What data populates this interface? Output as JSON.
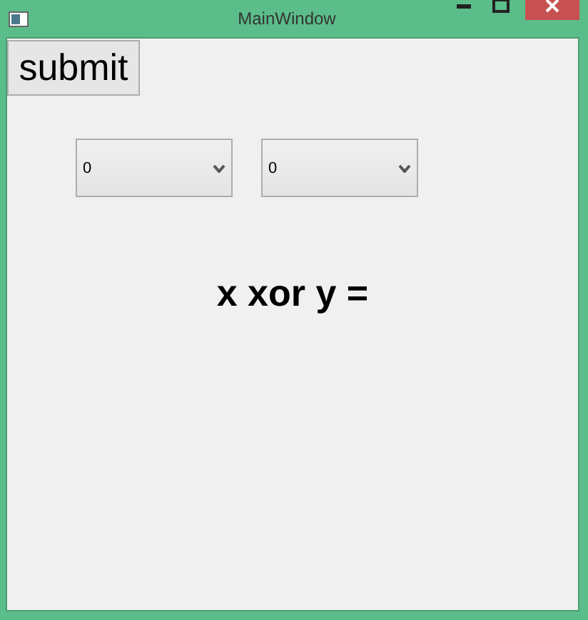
{
  "window": {
    "title": "MainWindow"
  },
  "submit_button": {
    "label": "submit"
  },
  "combos": [
    {
      "value": "0"
    },
    {
      "value": "0"
    }
  ],
  "result_label": "x xor y ="
}
